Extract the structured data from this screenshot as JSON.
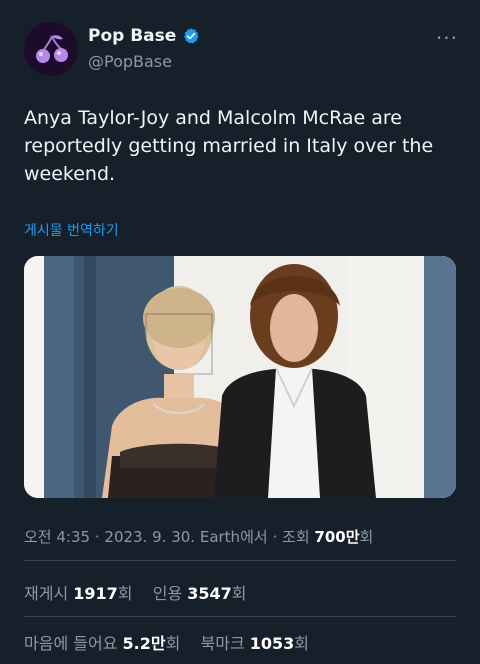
{
  "author": {
    "display_name": "Pop Base",
    "handle": "@PopBase",
    "verified_icon": "verified-badge-icon",
    "avatar_icon": "cherry-logo-icon",
    "more_icon": "more-options-icon"
  },
  "tweet": {
    "text": "Anya Taylor-Joy and Malcolm McRae are reportedly getting married in Italy over the weekend.",
    "translate_label": "게시물 번역하기",
    "image_icon": "photo-of-couple"
  },
  "meta": {
    "time": "오전 4:35",
    "sep1": "·",
    "date": "2023. 9. 30.",
    "source": "Earth에서",
    "sep2": "·",
    "views_label_pre": "조회",
    "views_value": "700만",
    "views_label_post": "회"
  },
  "stats_row1": {
    "reposts_label": "재게시",
    "reposts_value": "1917",
    "reposts_suffix": "회",
    "quotes_label": "인용",
    "quotes_value": "3547",
    "quotes_suffix": "회"
  },
  "stats_row2": {
    "likes_label": "마음에 들어요",
    "likes_value": "5.2만",
    "likes_suffix": "회",
    "bookmarks_label": "북마크",
    "bookmarks_value": "1053",
    "bookmarks_suffix": "회"
  },
  "colors": {
    "background": "#15202b",
    "accent": "#1d9bf0",
    "muted": "#8b98a5"
  }
}
